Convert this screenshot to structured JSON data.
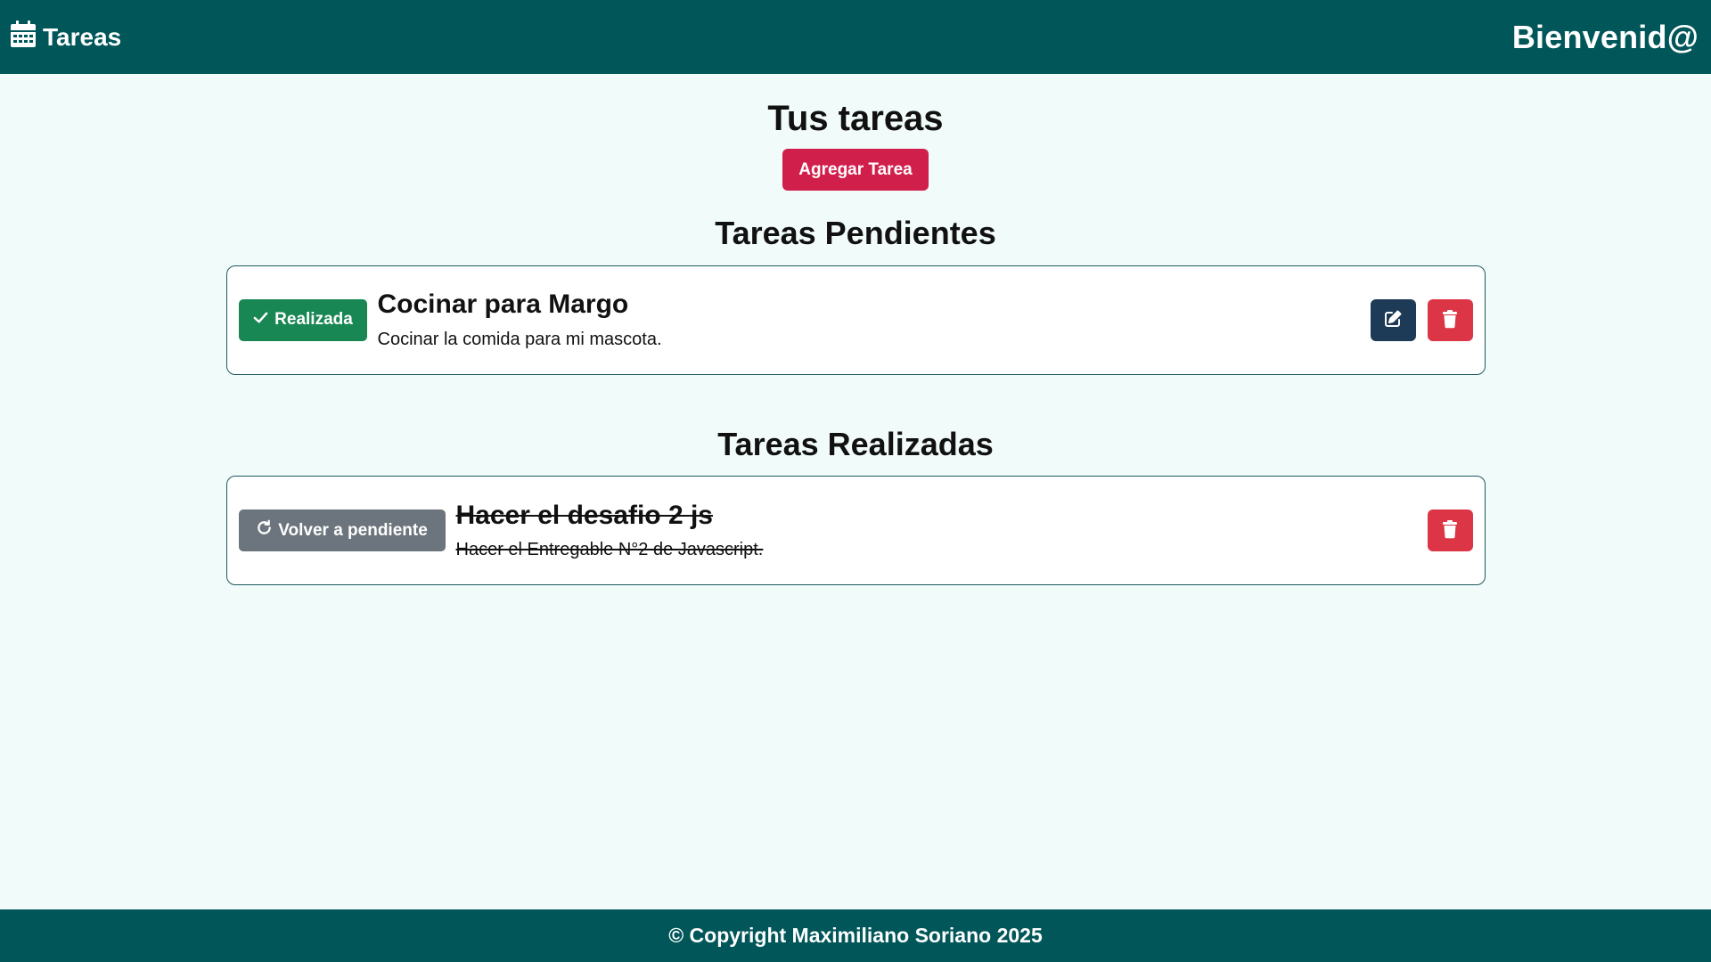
{
  "navbar": {
    "brand_label": "Tareas",
    "brand_icon": "calendar-icon",
    "welcome": "Bienvenid@"
  },
  "main": {
    "title": "Tus tareas",
    "add_button": "Agregar Tarea",
    "pending_title": "Tareas Pendientes",
    "done_title": "Tareas Realizadas",
    "pending_tasks": [
      {
        "status_label": "Realizada",
        "title": "Cocinar para Margo",
        "description": "Cocinar la comida para mi mascota."
      }
    ],
    "done_tasks": [
      {
        "status_label": "Volver a pendiente",
        "title": "Hacer el desafio 2 js",
        "description": "Hacer el Entregable N°2 de Javascript."
      }
    ]
  },
  "footer": {
    "text": "© Copyright Maximiliano Soriano 2025"
  },
  "colors": {
    "navbar": "#005659",
    "background": "#f1fbf9",
    "add_button": "#d11f4c",
    "success": "#198754",
    "secondary": "#6c757d",
    "edit": "#1d3a56",
    "danger": "#dc3545"
  }
}
